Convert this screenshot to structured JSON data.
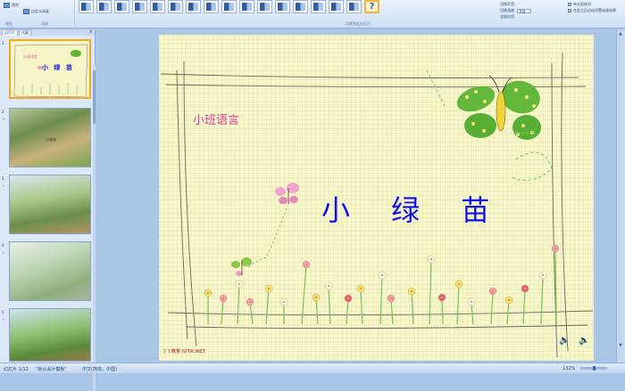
{
  "ribbon": {
    "left_buttons": [
      {
        "label": "预览"
      },
      {
        "label": "自定义动画"
      }
    ],
    "group_labels": [
      "预览",
      "动画",
      "切换到此幻灯片"
    ],
    "transition_count": 16,
    "help_glyph": "?",
    "options": {
      "sound_label": "切换声音:",
      "speed_label": "切换速度:",
      "speed_value": "快速",
      "apply_all_label": "全部应用",
      "advance_on_click_label": "单击鼠标时",
      "advance_after_label": "在此之后自动设置动画效果"
    }
  },
  "left_pane": {
    "tabs": [
      "幻灯片",
      "大纲"
    ],
    "close_glyph": "×",
    "slides": [
      {
        "num": "1",
        "subtitle": "小班语言",
        "title": "小 绿 苗"
      },
      {
        "num": "2",
        "caption": "小绿苗"
      },
      {
        "num": "3"
      },
      {
        "num": "4"
      },
      {
        "num": "5"
      }
    ]
  },
  "slide": {
    "subtitle": "小班语言",
    "title": "小 绿 苗",
    "butterfly_label": "Butterfly",
    "watermark": "丫丫教育 GITK.NET",
    "speaker_glyph": "🔈",
    "colors": {
      "background": "#f7f7c9",
      "title": "#1010ee",
      "subtitle": "#e0409a"
    }
  },
  "statusbar": {
    "slide_info": "幻灯片 1/12",
    "theme": "\"默认设计模板\"",
    "language": "中文(简体，中国)",
    "zoom": "132%"
  }
}
